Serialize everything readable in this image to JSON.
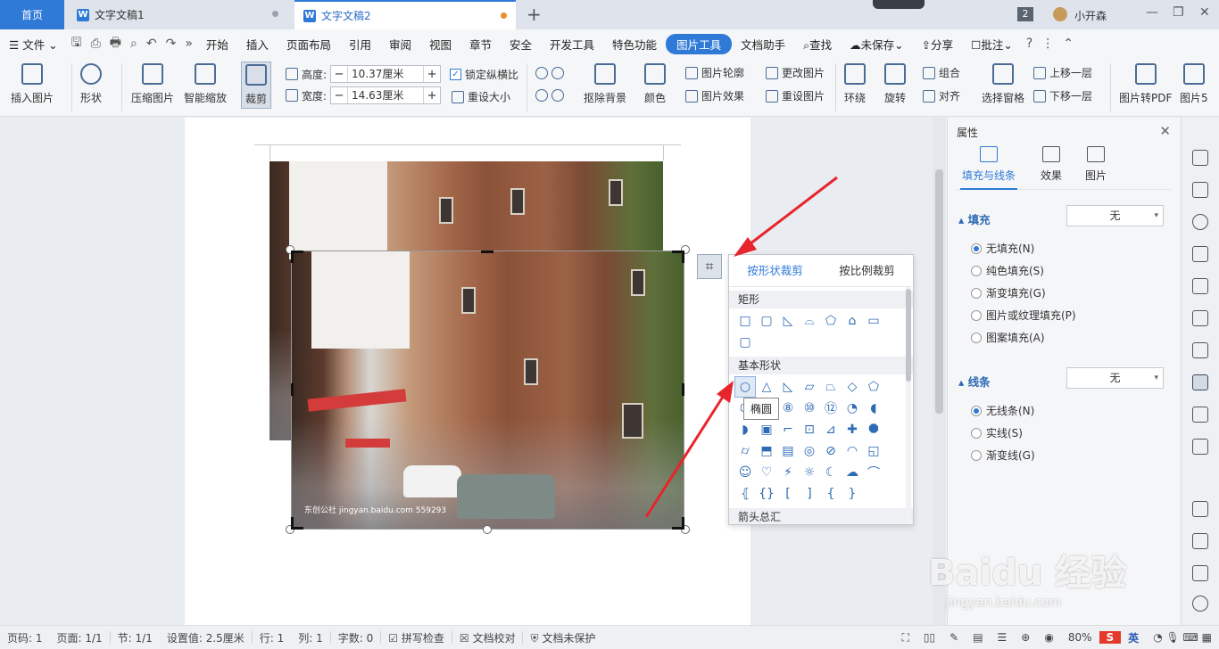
{
  "tabs": {
    "home": "首页",
    "doc1": "文字文稿1",
    "doc2": "文字文稿2",
    "new_tab": "+"
  },
  "topbar": {
    "doc_count": "2",
    "user": "小开森"
  },
  "menu": {
    "file": "文件",
    "items": [
      "开始",
      "插入",
      "页面布局",
      "引用",
      "审阅",
      "视图",
      "章节",
      "安全",
      "开发工具",
      "特色功能"
    ],
    "active": "图片工具",
    "doc_helper": "文档助手",
    "search": "查找",
    "unsaved": "未保存",
    "share": "分享",
    "comment": "批注"
  },
  "ribbon": {
    "insert_picture": "插入图片",
    "shape": "形状",
    "compress": "压缩图片",
    "smart_zoom": "智能缩放",
    "crop": "裁剪",
    "height_label": "高度:",
    "height_value": "10.37厘米",
    "width_label": "宽度:",
    "width_value": "14.63厘米",
    "lock_ratio": "锁定纵横比",
    "reset_size": "重设大小",
    "remove_bg": "抠除背景",
    "color": "颜色",
    "outline": "图片轮廓",
    "effect": "图片效果",
    "change_pic": "更改图片",
    "reset_pic": "重设图片",
    "wrap": "环绕",
    "rotate": "旋转",
    "group": "组合",
    "align": "对齐",
    "select_pane": "选择窗格",
    "bring_forward": "上移一层",
    "send_backward": "下移一层",
    "to_pdf": "图片转PDF",
    "pic_more": "图片5"
  },
  "crop_popup": {
    "tab_shape": "按形状裁剪",
    "tab_ratio": "按比例裁剪",
    "section_rect": "矩形",
    "section_basic": "基本形状",
    "section_arrows": "箭头总汇",
    "tooltip": "椭圆",
    "rect_shapes": [
      "□",
      "▢",
      "◺",
      "⌓",
      "⬠",
      "⌂",
      "▭",
      "▢"
    ],
    "basic_shapes": [
      "○",
      "△",
      "◺",
      "▱",
      "⏢",
      "◇",
      "⬠",
      "⬡",
      "⑦",
      "⑧",
      "⑩",
      "⑫",
      "◔",
      "◖",
      "◗",
      "▣",
      "⌐",
      "⊡",
      "⊿",
      "✚",
      "⯃",
      "⌭",
      "⬒",
      "▤",
      "◎",
      "⊘",
      "◠",
      "◱",
      "☺",
      "♡",
      "⚡",
      "☼",
      "☾",
      "☁",
      "⌒",
      "⦃",
      "{}",
      "[",
      "]",
      "{",
      "}"
    ],
    "arrow_shapes": [
      "⇨",
      "⇦",
      "⇧",
      "⇩",
      "⬄",
      "⇳",
      "✥",
      "⬆"
    ]
  },
  "picture": {
    "caption": "东创公社 jingyan.baidu.com 559293"
  },
  "properties": {
    "title": "属性",
    "tab_fill": "填充与线条",
    "tab_effect": "效果",
    "tab_picture": "图片",
    "fill_section": "填充",
    "fill_value": "无",
    "fill_options": [
      "无填充(N)",
      "纯色填充(S)",
      "渐变填充(G)",
      "图片或纹理填充(P)",
      "图案填充(A)"
    ],
    "line_section": "线条",
    "line_value": "无",
    "line_options": [
      "无线条(N)",
      "实线(S)",
      "渐变线(G)"
    ]
  },
  "status": {
    "page": "页码: 1",
    "pages": "页面: 1/1",
    "section": "节: 1/1",
    "setting": "设置值: 2.5厘米",
    "row": "行: 1",
    "col": "列: 1",
    "words": "字数: 0",
    "spell": "拼写检查",
    "proof": "文档校对",
    "protect": "文档未保护",
    "zoom": "80%",
    "ime": "英"
  },
  "watermark": {
    "main": "Baidu 经验",
    "sub": "jingyan.baidu.com"
  },
  "colors": {
    "accent": "#2f7ad6",
    "arrow": "#e8242c"
  }
}
